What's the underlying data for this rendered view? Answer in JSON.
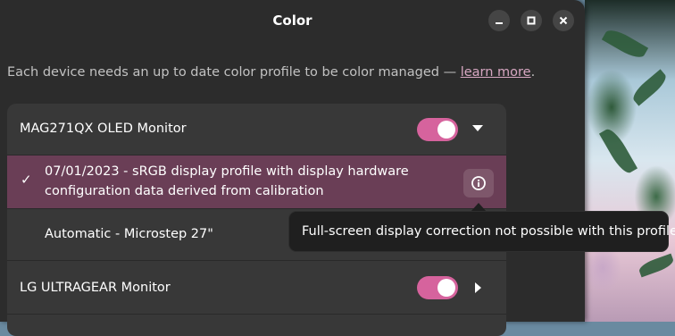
{
  "window": {
    "title": "Color",
    "minimize_icon": "minimize-icon",
    "maximize_icon": "maximize-icon",
    "close_icon": "close-icon"
  },
  "description": {
    "text": "Each device needs an up to date color profile to be color managed — ",
    "link": "learn more",
    "suffix": "."
  },
  "devices": [
    {
      "name": "MAG271QX OLED Monitor",
      "enabled": true,
      "expanded": true,
      "profiles": [
        {
          "label_line1": "07/01/2023 - sRGB display profile with display hardware",
          "label_line2": "configuration data derived from calibration",
          "selected": true,
          "info_icon": "info-icon"
        },
        {
          "label": "Automatic - Microstep 27\"",
          "selected": false
        }
      ]
    },
    {
      "name": "LG ULTRAGEAR Monitor",
      "enabled": true,
      "expanded": false
    }
  ],
  "tooltip": {
    "text": "Full-screen display correction not possible with this profile"
  },
  "colors": {
    "accent": "#d6639d",
    "selected_row": "#6a3e56",
    "window_bg": "#2c2c2c",
    "card_bg": "#383838"
  }
}
